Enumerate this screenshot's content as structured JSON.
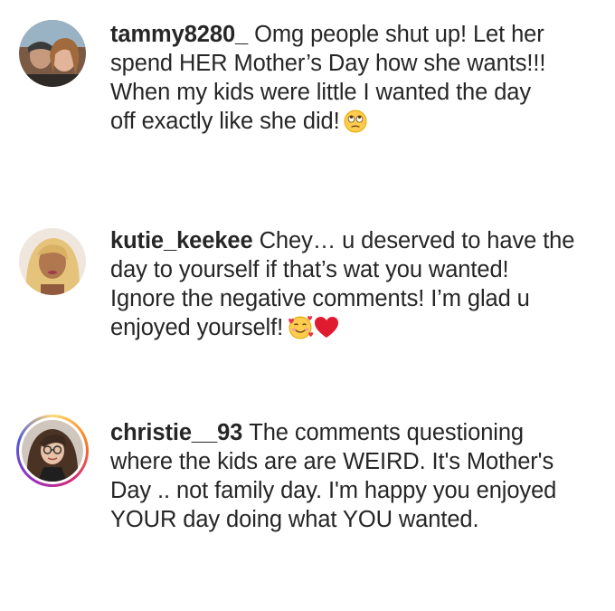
{
  "comments": [
    {
      "username": "tammy8280_",
      "lines": [
        "Omg people shut up! Let her",
        "spend HER Mother’s Day how she wants!!!",
        "When my kids were little I wanted the day",
        "off exactly like she did!"
      ],
      "emoji": [
        "face-with-rolling-eyes-icon"
      ],
      "story_ring": false
    },
    {
      "username": "kutie_keekee",
      "lines": [
        "Chey… u deserved to have the",
        "day to yourself if that’s wat you wanted!",
        "Ignore the negative comments! I’m glad u",
        "enjoyed yourself!"
      ],
      "emoji": [
        "smiling-face-with-hearts-icon",
        "red-heart-icon"
      ],
      "story_ring": false
    },
    {
      "username": "christie__93",
      "lines": [
        "The comments questioning",
        "where the kids are are WEIRD. It's Mother's",
        "Day .. not family day. I'm happy you enjoyed",
        "YOUR day doing what YOU wanted."
      ],
      "emoji": [],
      "story_ring": true
    }
  ],
  "colors": {
    "text": "#262626",
    "ring_gradient": [
      "#feda75",
      "#fa7e1e",
      "#d62976",
      "#962fbf",
      "#4f5bd5"
    ]
  }
}
